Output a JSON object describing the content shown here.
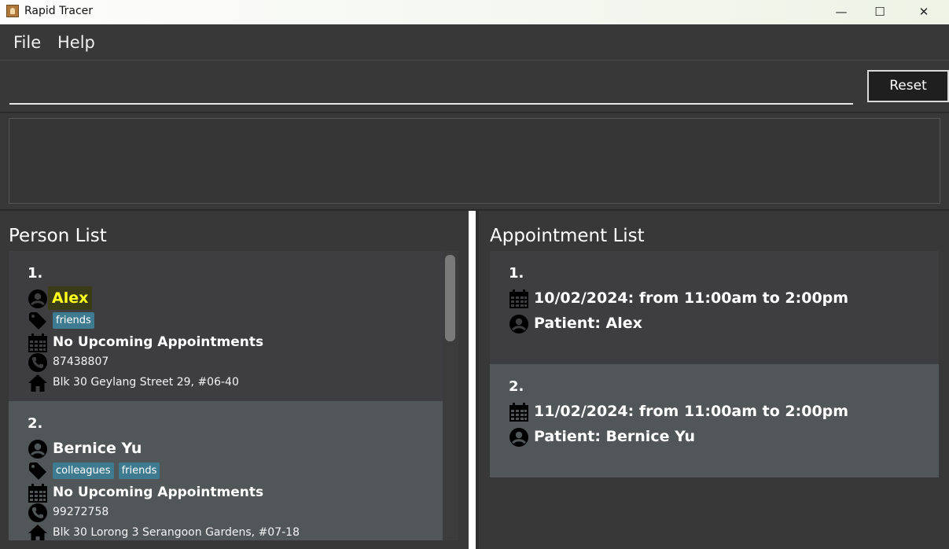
{
  "window": {
    "title": "Rapid Tracer",
    "minimize_glyph": "—",
    "maximize_glyph": "☐",
    "close_glyph": "✕"
  },
  "menu": {
    "file": "File",
    "help": "Help"
  },
  "command": {
    "value": "",
    "reset_label": "Reset"
  },
  "result_display": {
    "text": ""
  },
  "person_list": {
    "title": "Person List",
    "persons": [
      {
        "index": "1.",
        "name": "Alex",
        "tags": [
          "friends"
        ],
        "appointments": "No Upcoming Appointments",
        "phone": "87438807",
        "address": "Blk 30 Geylang Street 29, #06-40"
      },
      {
        "index": "2.",
        "name": "Bernice Yu",
        "tags": [
          "colleagues",
          "friends"
        ],
        "appointments": "No Upcoming Appointments",
        "phone": "99272758",
        "address": "Blk 30 Lorong 3 Serangoon Gardens, #07-18"
      }
    ]
  },
  "appointment_list": {
    "title": "Appointment List",
    "appointments": [
      {
        "index": "1.",
        "time": "10/02/2024: from 11:00am to 2:00pm",
        "patient": "Patient: Alex"
      },
      {
        "index": "2.",
        "time": "11/02/2024: from 11:00am to 2:00pm",
        "patient": "Patient: Bernice Yu"
      }
    ]
  },
  "colors": {
    "tag": "#3e7b91",
    "highlight_name": "#ffff1e",
    "card_dark": "#3e3e40",
    "card_light": "#515658"
  }
}
